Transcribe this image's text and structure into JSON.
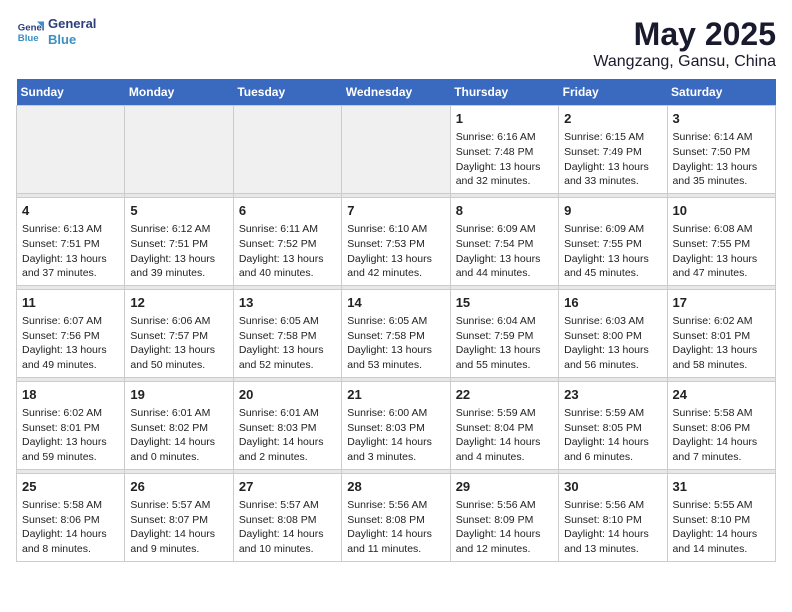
{
  "header": {
    "logo_line1": "General",
    "logo_line2": "Blue",
    "title": "May 2025",
    "subtitle": "Wangzang, Gansu, China"
  },
  "weekdays": [
    "Sunday",
    "Monday",
    "Tuesday",
    "Wednesday",
    "Thursday",
    "Friday",
    "Saturday"
  ],
  "weeks": [
    [
      {
        "day": "",
        "info": "",
        "empty": true
      },
      {
        "day": "",
        "info": "",
        "empty": true
      },
      {
        "day": "",
        "info": "",
        "empty": true
      },
      {
        "day": "",
        "info": "",
        "empty": true
      },
      {
        "day": "1",
        "info": "Sunrise: 6:16 AM\nSunset: 7:48 PM\nDaylight: 13 hours\nand 32 minutes."
      },
      {
        "day": "2",
        "info": "Sunrise: 6:15 AM\nSunset: 7:49 PM\nDaylight: 13 hours\nand 33 minutes."
      },
      {
        "day": "3",
        "info": "Sunrise: 6:14 AM\nSunset: 7:50 PM\nDaylight: 13 hours\nand 35 minutes."
      }
    ],
    [
      {
        "day": "4",
        "info": "Sunrise: 6:13 AM\nSunset: 7:51 PM\nDaylight: 13 hours\nand 37 minutes."
      },
      {
        "day": "5",
        "info": "Sunrise: 6:12 AM\nSunset: 7:51 PM\nDaylight: 13 hours\nand 39 minutes."
      },
      {
        "day": "6",
        "info": "Sunrise: 6:11 AM\nSunset: 7:52 PM\nDaylight: 13 hours\nand 40 minutes."
      },
      {
        "day": "7",
        "info": "Sunrise: 6:10 AM\nSunset: 7:53 PM\nDaylight: 13 hours\nand 42 minutes."
      },
      {
        "day": "8",
        "info": "Sunrise: 6:09 AM\nSunset: 7:54 PM\nDaylight: 13 hours\nand 44 minutes."
      },
      {
        "day": "9",
        "info": "Sunrise: 6:09 AM\nSunset: 7:55 PM\nDaylight: 13 hours\nand 45 minutes."
      },
      {
        "day": "10",
        "info": "Sunrise: 6:08 AM\nSunset: 7:55 PM\nDaylight: 13 hours\nand 47 minutes."
      }
    ],
    [
      {
        "day": "11",
        "info": "Sunrise: 6:07 AM\nSunset: 7:56 PM\nDaylight: 13 hours\nand 49 minutes."
      },
      {
        "day": "12",
        "info": "Sunrise: 6:06 AM\nSunset: 7:57 PM\nDaylight: 13 hours\nand 50 minutes."
      },
      {
        "day": "13",
        "info": "Sunrise: 6:05 AM\nSunset: 7:58 PM\nDaylight: 13 hours\nand 52 minutes."
      },
      {
        "day": "14",
        "info": "Sunrise: 6:05 AM\nSunset: 7:58 PM\nDaylight: 13 hours\nand 53 minutes."
      },
      {
        "day": "15",
        "info": "Sunrise: 6:04 AM\nSunset: 7:59 PM\nDaylight: 13 hours\nand 55 minutes."
      },
      {
        "day": "16",
        "info": "Sunrise: 6:03 AM\nSunset: 8:00 PM\nDaylight: 13 hours\nand 56 minutes."
      },
      {
        "day": "17",
        "info": "Sunrise: 6:02 AM\nSunset: 8:01 PM\nDaylight: 13 hours\nand 58 minutes."
      }
    ],
    [
      {
        "day": "18",
        "info": "Sunrise: 6:02 AM\nSunset: 8:01 PM\nDaylight: 13 hours\nand 59 minutes."
      },
      {
        "day": "19",
        "info": "Sunrise: 6:01 AM\nSunset: 8:02 PM\nDaylight: 14 hours\nand 0 minutes."
      },
      {
        "day": "20",
        "info": "Sunrise: 6:01 AM\nSunset: 8:03 PM\nDaylight: 14 hours\nand 2 minutes."
      },
      {
        "day": "21",
        "info": "Sunrise: 6:00 AM\nSunset: 8:03 PM\nDaylight: 14 hours\nand 3 minutes."
      },
      {
        "day": "22",
        "info": "Sunrise: 5:59 AM\nSunset: 8:04 PM\nDaylight: 14 hours\nand 4 minutes."
      },
      {
        "day": "23",
        "info": "Sunrise: 5:59 AM\nSunset: 8:05 PM\nDaylight: 14 hours\nand 6 minutes."
      },
      {
        "day": "24",
        "info": "Sunrise: 5:58 AM\nSunset: 8:06 PM\nDaylight: 14 hours\nand 7 minutes."
      }
    ],
    [
      {
        "day": "25",
        "info": "Sunrise: 5:58 AM\nSunset: 8:06 PM\nDaylight: 14 hours\nand 8 minutes."
      },
      {
        "day": "26",
        "info": "Sunrise: 5:57 AM\nSunset: 8:07 PM\nDaylight: 14 hours\nand 9 minutes."
      },
      {
        "day": "27",
        "info": "Sunrise: 5:57 AM\nSunset: 8:08 PM\nDaylight: 14 hours\nand 10 minutes."
      },
      {
        "day": "28",
        "info": "Sunrise: 5:56 AM\nSunset: 8:08 PM\nDaylight: 14 hours\nand 11 minutes."
      },
      {
        "day": "29",
        "info": "Sunrise: 5:56 AM\nSunset: 8:09 PM\nDaylight: 14 hours\nand 12 minutes."
      },
      {
        "day": "30",
        "info": "Sunrise: 5:56 AM\nSunset: 8:10 PM\nDaylight: 14 hours\nand 13 minutes."
      },
      {
        "day": "31",
        "info": "Sunrise: 5:55 AM\nSunset: 8:10 PM\nDaylight: 14 hours\nand 14 minutes."
      }
    ]
  ]
}
